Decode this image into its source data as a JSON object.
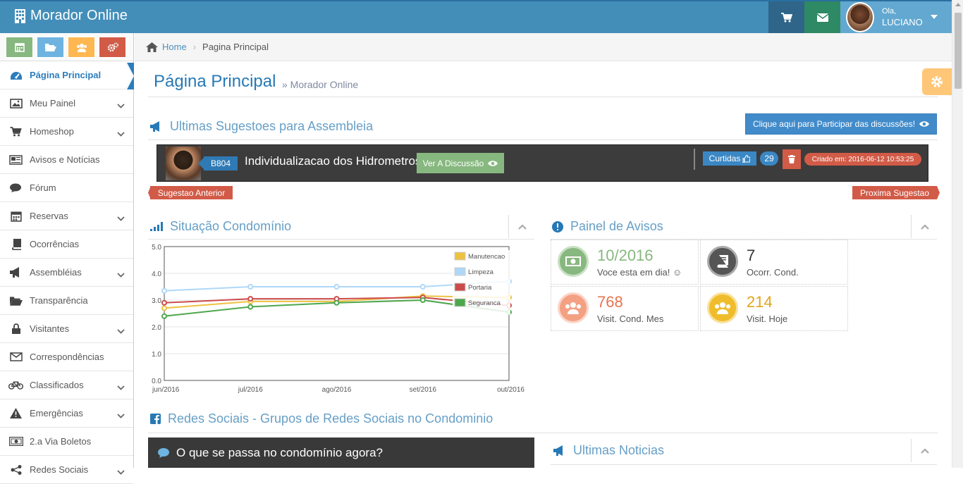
{
  "app": {
    "title": "Morador Online"
  },
  "user": {
    "greeting": "Ola,",
    "name": "LUCIANO"
  },
  "sidebar": {
    "items": [
      {
        "label": "Página Principal",
        "icon": "tachometer-icon",
        "active": true,
        "expandable": false
      },
      {
        "label": "Meu Painel",
        "icon": "picture-icon",
        "expandable": true
      },
      {
        "label": "Homeshop",
        "icon": "cart-icon",
        "expandable": true
      },
      {
        "label": "Avisos e Notícias",
        "icon": "newspaper-icon",
        "expandable": false
      },
      {
        "label": "Fórum",
        "icon": "comments-icon",
        "expandable": false
      },
      {
        "label": "Reservas",
        "icon": "calendar-icon",
        "expandable": true
      },
      {
        "label": "Ocorrências",
        "icon": "book-icon",
        "expandable": false
      },
      {
        "label": "Assembléias",
        "icon": "bullhorn-icon",
        "expandable": true
      },
      {
        "label": "Transparência",
        "icon": "folder-open-icon",
        "expandable": false
      },
      {
        "label": "Visitantes",
        "icon": "lock-icon",
        "expandable": true
      },
      {
        "label": "Correspondências",
        "icon": "envelope-icon",
        "expandable": false
      },
      {
        "label": "Classificados",
        "icon": "bicycle-icon",
        "expandable": true
      },
      {
        "label": "Emergências",
        "icon": "warning-icon",
        "expandable": true
      },
      {
        "label": "2.a Via Boletos",
        "icon": "money-icon",
        "expandable": false
      },
      {
        "label": "Redes Sociais",
        "icon": "share-icon",
        "expandable": true
      }
    ]
  },
  "breadcrumb": {
    "home": "Home",
    "current": "Pagina Principal"
  },
  "page": {
    "title": "Página Principal",
    "subtitle": "» Morador Online"
  },
  "suggestions": {
    "heading": "Ultimas Sugestoes para Assembleia",
    "participate_label": "Clique aqui para Participar das discussões!",
    "unit": "B804",
    "title": "Individualizacao dos Hidrometros",
    "view_label": "Ver A Discussão",
    "likes_label": "Curtidas",
    "likes_count": "29",
    "created": "Criado em: 2016-06-12 10:53:25",
    "prev_label": "Sugestao Anterior",
    "next_label": "Proxima Sugestao"
  },
  "situacao": {
    "heading": "Situação Condomínio"
  },
  "chart_data": {
    "type": "line",
    "categories": [
      "jun/2016",
      "jul/2016",
      "ago/2016",
      "set/2016",
      "out/2016"
    ],
    "ylim": [
      0,
      5
    ],
    "yticks": [
      "0.0",
      "1.0",
      "2.0",
      "3.0",
      "4.0",
      "5.0"
    ],
    "legend_position": "top-right",
    "grid": true,
    "series": [
      {
        "name": "Manutencao",
        "color": "#edc240",
        "values": [
          2.7,
          2.95,
          2.95,
          3.15,
          3.1
        ]
      },
      {
        "name": "Limpeza",
        "color": "#afd8f8",
        "values": [
          3.35,
          3.5,
          3.5,
          3.5,
          3.7
        ]
      },
      {
        "name": "Portaria",
        "color": "#cb4b4b",
        "values": [
          2.9,
          3.05,
          3.05,
          3.1,
          2.8
        ]
      },
      {
        "name": "Seguranca",
        "color": "#4da74d",
        "values": [
          2.4,
          2.75,
          2.9,
          3.0,
          2.55
        ]
      }
    ]
  },
  "avisos": {
    "heading": "Painel de Avisos",
    "cells": [
      {
        "value": "10/2016",
        "label": "Voce esta em dia! ☺",
        "color": "#87b87f",
        "icon": "money-icon"
      },
      {
        "value": "7",
        "label": "Ocorr. Cond.",
        "color": "#333333",
        "icon": "book-icon"
      },
      {
        "value": "768",
        "label": "Visit. Cond. Mes",
        "color": "#e8734f",
        "icon": "users-icon"
      },
      {
        "value": "214",
        "label": "Visit. Hoje",
        "color": "#e3a41a",
        "icon": "users-icon"
      }
    ]
  },
  "redes": {
    "heading": "Redes Sociais - Grupos de Redes Sociais no Condominio",
    "box_title": "O que se passa no condomínio agora?"
  },
  "noticias": {
    "heading": "Ultimas Noticias"
  }
}
